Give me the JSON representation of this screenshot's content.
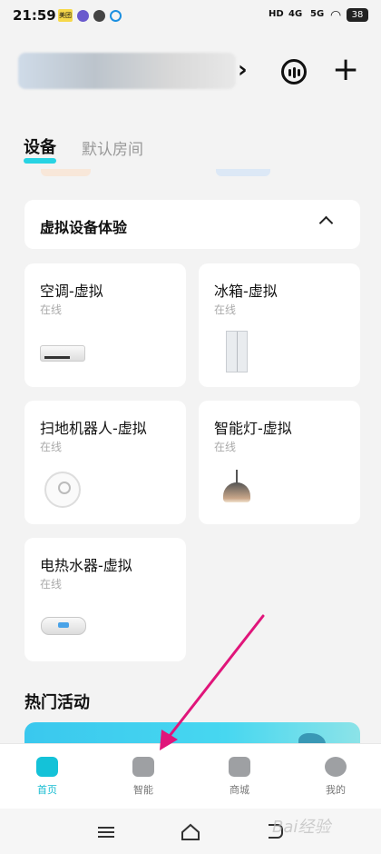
{
  "status_bar": {
    "time": "21:59",
    "chip_label": "美团",
    "signal": [
      "HD",
      "4G",
      "5G"
    ],
    "battery": "38"
  },
  "header": {
    "home_name": ""
  },
  "tabs": [
    {
      "label": "设备",
      "active": true
    },
    {
      "label": "默认房间",
      "active": false
    }
  ],
  "section": {
    "title": "虚拟设备体验"
  },
  "devices": [
    {
      "name": "空调-虚拟",
      "status": "在线",
      "icon": "air-conditioner"
    },
    {
      "name": "冰箱-虚拟",
      "status": "在线",
      "icon": "refrigerator"
    },
    {
      "name": "扫地机器人-虚拟",
      "status": "在线",
      "icon": "robot-vacuum"
    },
    {
      "name": "智能灯-虚拟",
      "status": "在线",
      "icon": "pendant-lamp"
    },
    {
      "name": "电热水器-虚拟",
      "status": "在线",
      "icon": "water-heater"
    }
  ],
  "hot": {
    "title": "热门活动"
  },
  "tab_bar": [
    {
      "label": "首页",
      "icon": "home-icon",
      "active": true
    },
    {
      "label": "智能",
      "icon": "android-icon",
      "active": false
    },
    {
      "label": "商城",
      "icon": "shop-bag-icon",
      "active": false
    },
    {
      "label": "我的",
      "icon": "profile-icon",
      "active": false
    }
  ],
  "colors": {
    "accent": "#14c2d8",
    "arrow": "#e0157a"
  },
  "watermark": "Bai经验"
}
